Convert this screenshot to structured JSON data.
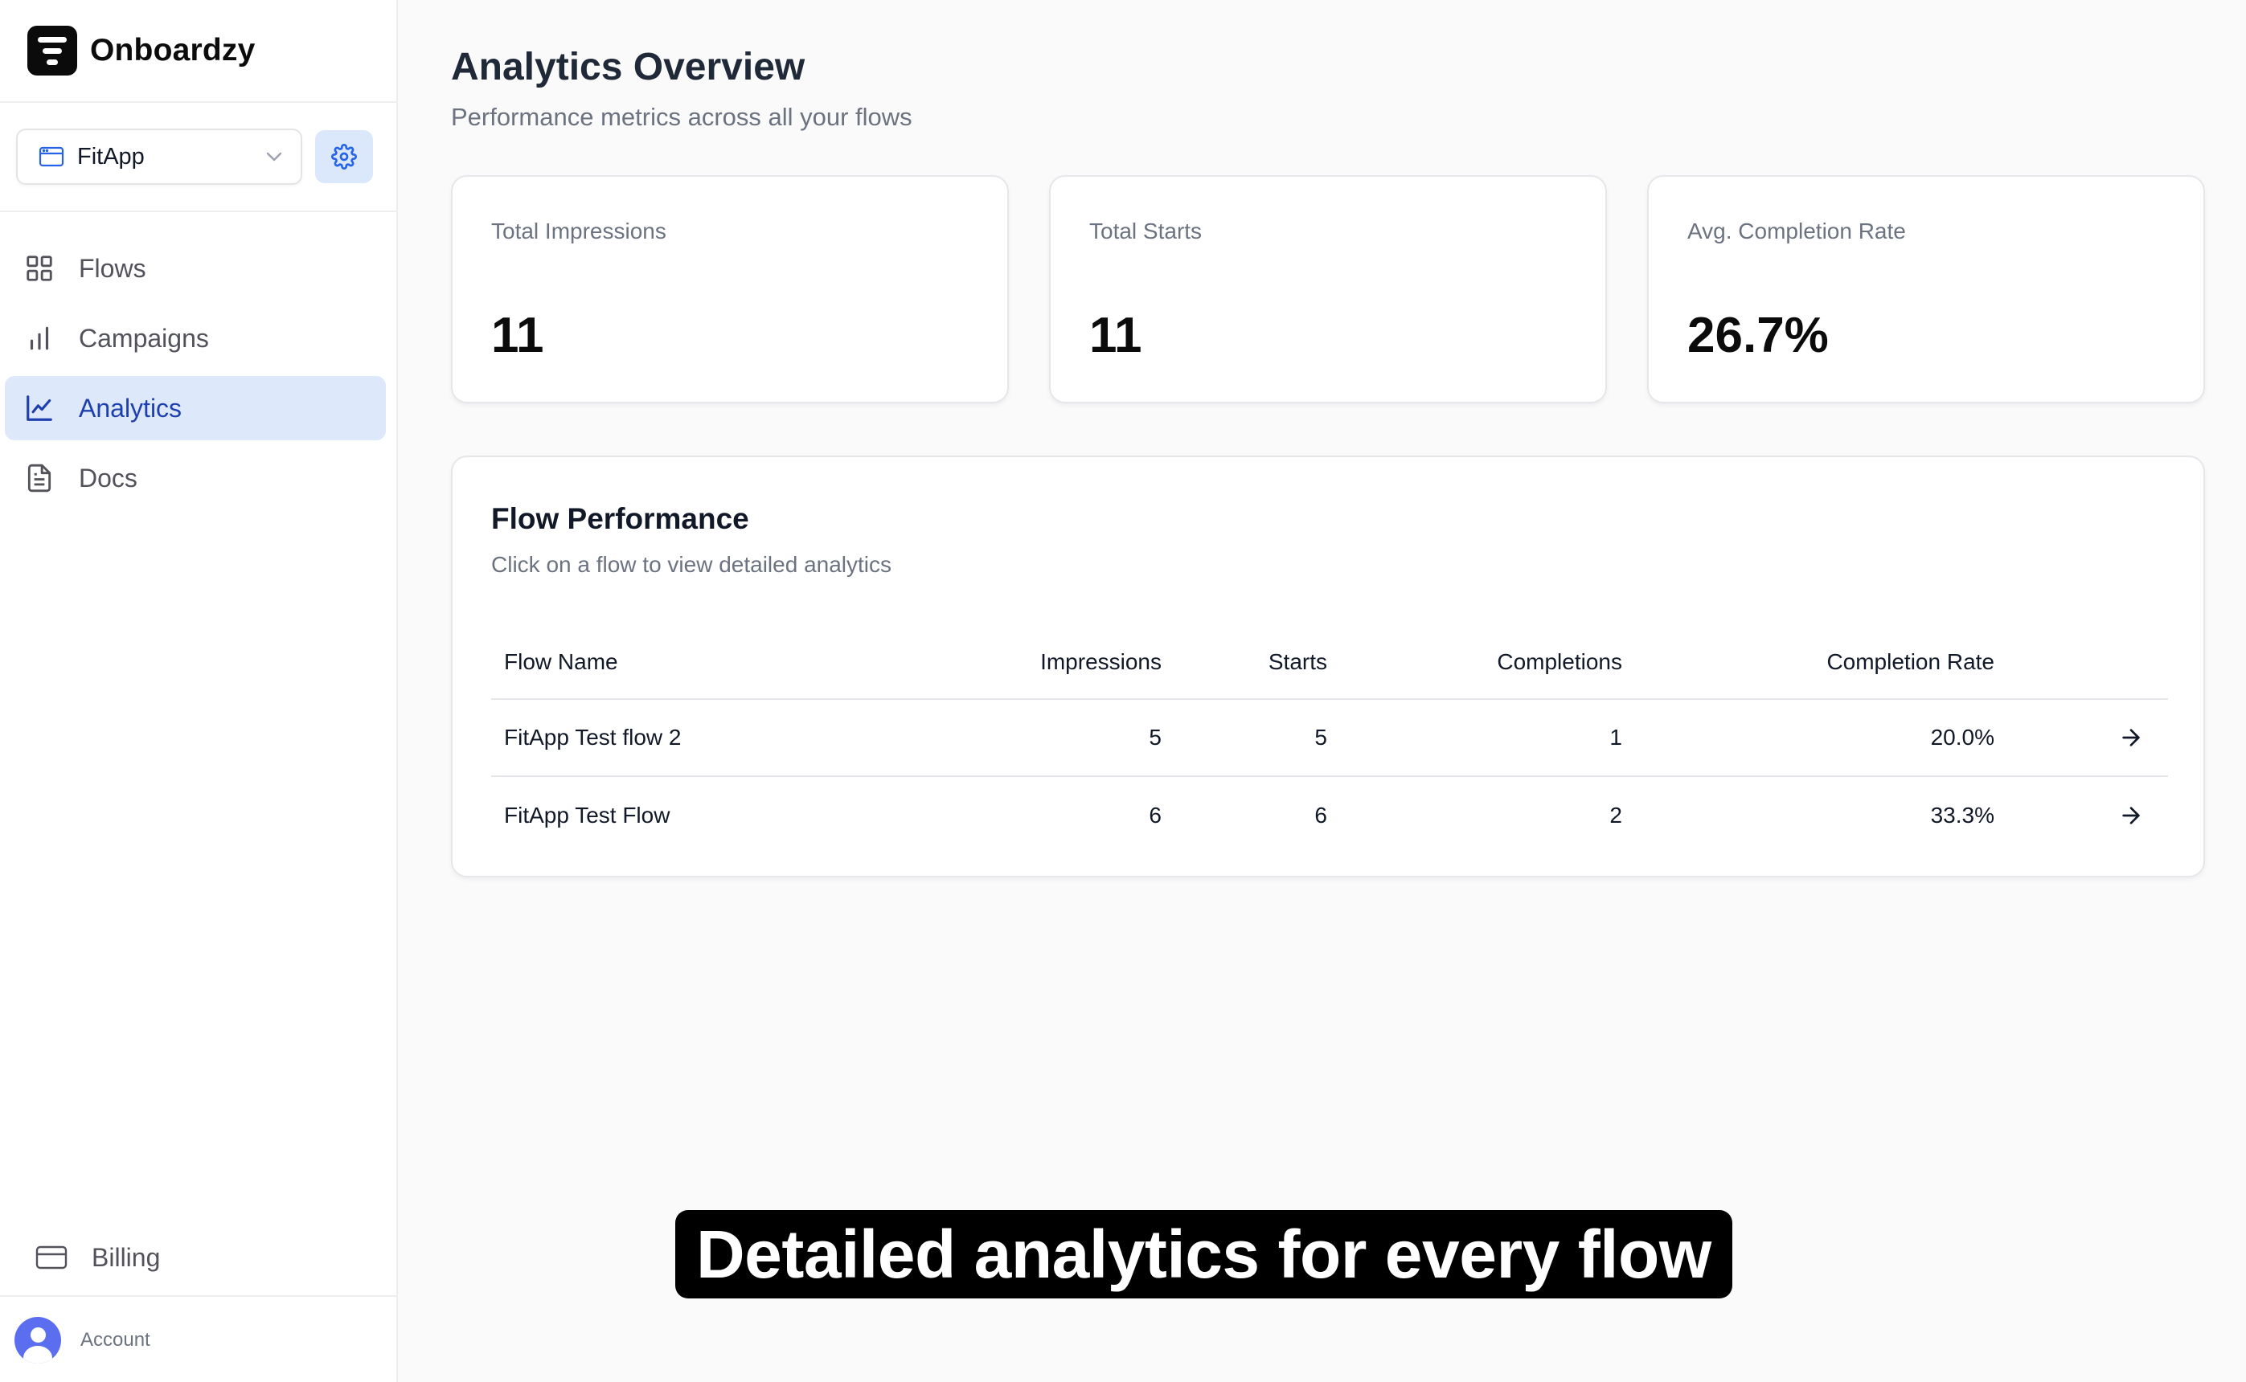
{
  "brand": {
    "name": "Onboardzy"
  },
  "app_switcher": {
    "selected_app": "FitApp"
  },
  "sidebar": {
    "items": [
      {
        "label": "Flows",
        "icon": "grid-icon"
      },
      {
        "label": "Campaigns",
        "icon": "bar-chart-icon"
      },
      {
        "label": "Analytics",
        "icon": "line-chart-icon",
        "active": true
      },
      {
        "label": "Docs",
        "icon": "document-icon"
      }
    ],
    "billing_label": "Billing",
    "account_label": "Account"
  },
  "page": {
    "title": "Analytics Overview",
    "subtitle": "Performance metrics across all your flows"
  },
  "stats": [
    {
      "label": "Total Impressions",
      "value": "11"
    },
    {
      "label": "Total Starts",
      "value": "11"
    },
    {
      "label": "Avg. Completion Rate",
      "value": "26.7%"
    }
  ],
  "flow_performance": {
    "title": "Flow Performance",
    "subtitle": "Click on a flow to view detailed analytics",
    "columns": {
      "name": "Flow Name",
      "impressions": "Impressions",
      "starts": "Starts",
      "completions": "Completions",
      "rate": "Completion Rate"
    },
    "rows": [
      {
        "name": "FitApp Test flow 2",
        "impressions": "5",
        "starts": "5",
        "completions": "1",
        "rate": "20.0%"
      },
      {
        "name": "FitApp Test Flow",
        "impressions": "6",
        "starts": "6",
        "completions": "2",
        "rate": "33.3%"
      }
    ]
  },
  "caption": "Detailed analytics for every flow",
  "colors": {
    "accent": "#1e40af",
    "active_nav_bg": "#dde8fb",
    "settings_bg": "#dbe7fb",
    "brand_dark": "#0b0b0b"
  }
}
